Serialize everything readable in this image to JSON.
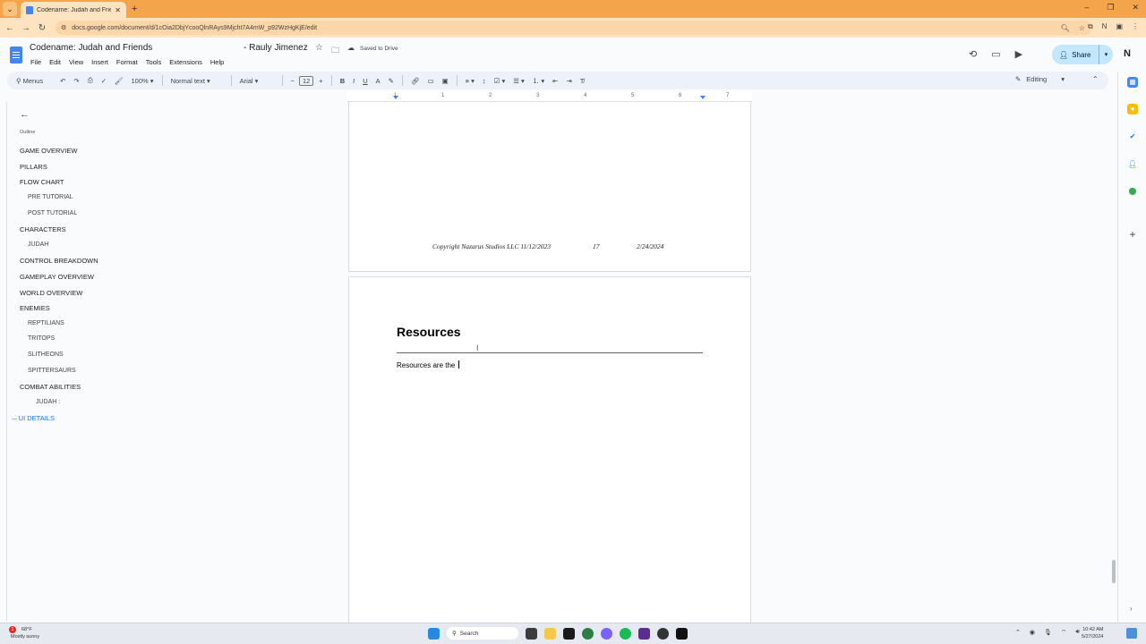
{
  "browser": {
    "tab_title": "Codename: Judah and Friends",
    "url": "docs.google.com/document/d/1cOia2DbjYcooQlnRAys9Mjcht7A4mW_p92WzHgKjE/edit"
  },
  "doc": {
    "title": "Codename: Judah and Friends",
    "owner": "- Rauly Jimenez",
    "saved_status": "Saved to Drive",
    "menus": [
      "File",
      "Edit",
      "View",
      "Insert",
      "Format",
      "Tools",
      "Extensions",
      "Help"
    ],
    "share_label": "Share"
  },
  "toolbar": {
    "menus_search": "Menus",
    "zoom": "100%",
    "style": "Normal text",
    "font": "Arial",
    "font_size": "12",
    "mode": "Editing"
  },
  "ruler": [
    "1",
    "1",
    "2",
    "3",
    "4",
    "5",
    "6",
    "7"
  ],
  "outline": {
    "label": "Outline",
    "items": [
      {
        "text": "GAME OVERVIEW",
        "level": 1
      },
      {
        "text": "PILLARS",
        "level": 1
      },
      {
        "text": "FLOW CHART",
        "level": 1
      },
      {
        "text": "PRE TUTORIAL",
        "level": 2
      },
      {
        "text": "POST TUTORIAL",
        "level": 2
      },
      {
        "text": "CHARACTERS",
        "level": 1
      },
      {
        "text": "JUDAH",
        "level": 2
      },
      {
        "text": "CONTROL BREAKDOWN",
        "level": 1
      },
      {
        "text": "GAMEPLAY OVERVIEW",
        "level": 1
      },
      {
        "text": "WORLD OVERVIEW",
        "level": 1
      },
      {
        "text": "ENEMIES",
        "level": 1
      },
      {
        "text": "REPTILIANS",
        "level": 2
      },
      {
        "text": "TRITOPS",
        "level": 2
      },
      {
        "text": "SLITHEONS",
        "level": 2
      },
      {
        "text": "SPITTERSAURS",
        "level": 2
      },
      {
        "text": "COMBAT ABILITIES",
        "level": 1
      },
      {
        "text": "JUDAH :",
        "level": 3
      },
      {
        "text": "UI DETAILS",
        "level": 1
      }
    ]
  },
  "page1_footer": {
    "copyright": "Copyright Nazarus Studios LLC 11/12/2023",
    "page_number": "17",
    "date": "2/24/2024"
  },
  "page2": {
    "heading": "Resources",
    "body": "Resources are the "
  },
  "taskbar": {
    "weather_temp": "68°F",
    "weather_desc": "Mostly sunny",
    "weather_badge": "1",
    "search_label": "Search",
    "time": "10:42 AM",
    "date": "5/27/2024"
  }
}
